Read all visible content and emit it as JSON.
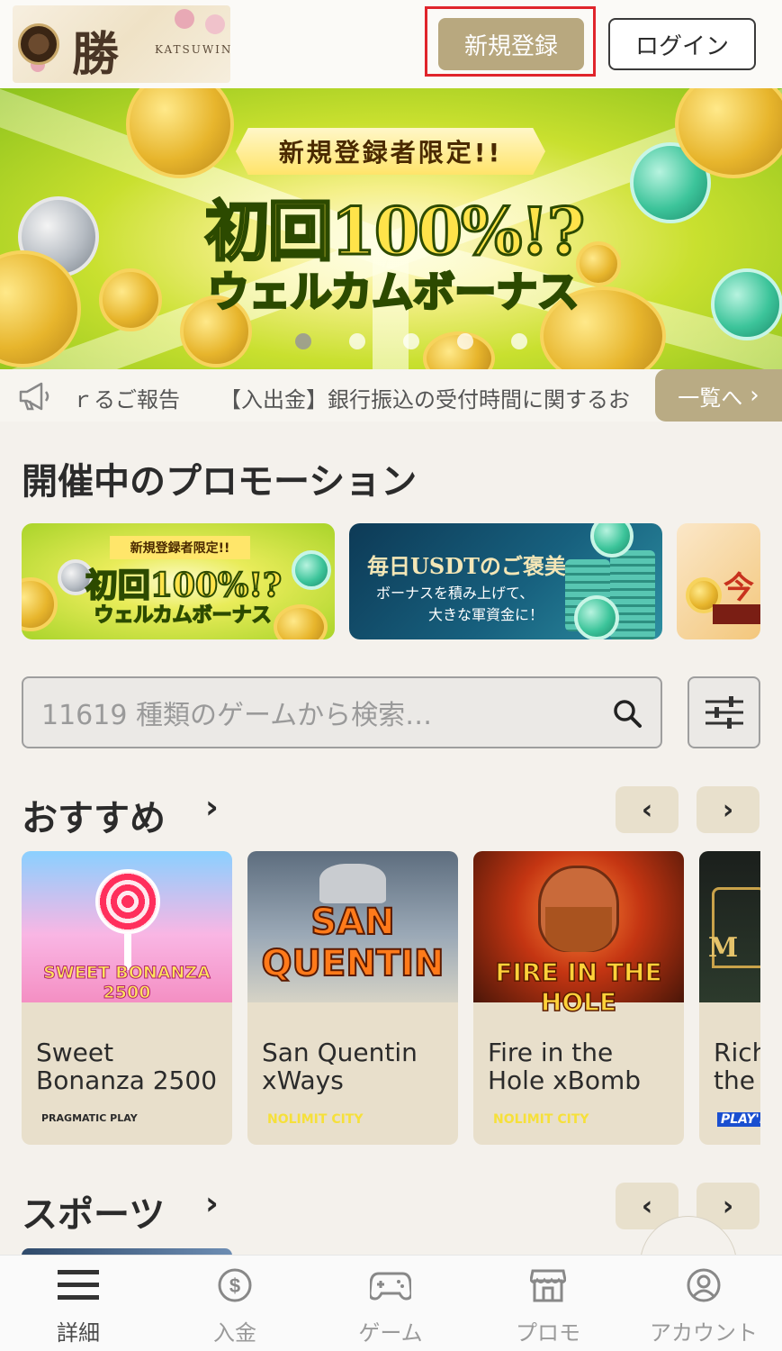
{
  "header": {
    "logo_kanji": "勝",
    "logo_brand": "KATSUWIN",
    "register_label": "新規登録",
    "login_label": "ログイン"
  },
  "banner": {
    "tag": "新規登録者限定!!",
    "main": "初回100%!?",
    "sub": "ウェルカムボーナス",
    "slide_count": 5,
    "active_slide": 1
  },
  "ticker": {
    "text1": "ｒるご報告",
    "text2": "【入出金】銀行振込の受付時間に関するお",
    "list_button": "一覧へ"
  },
  "promotions": {
    "title": "開催中のプロモーション",
    "card1": {
      "tag": "新規登録者限定!!",
      "main": "初回100%!?",
      "sub": "ウェルカムボーナス"
    },
    "card2": {
      "title": "毎日USDTのご褒美",
      "line1": "ボーナスを積み上げて、",
      "line2": "大きな軍資金に！"
    },
    "card3_text": "今"
  },
  "search": {
    "placeholder": "11619 種類のゲームから検索…"
  },
  "recommended": {
    "title": "おすすめ",
    "games": [
      {
        "name": "Sweet\nBonanza 2500",
        "art_title": "SWEET BONANZA 2500",
        "provider": "PRAGMATIC PLAY"
      },
      {
        "name": "San Quentin\nxWays",
        "art_title": "SAN QUENTIN",
        "provider": "NOLIMIT CITY"
      },
      {
        "name": "Fire in the\nHole xBomb",
        "art_title": "FIRE IN THE HOLE",
        "provider": "NOLIMIT CITY"
      },
      {
        "name": "Rich\nthe",
        "art_title": "M",
        "provider": "PLAY'n"
      }
    ]
  },
  "sports": {
    "title": "スポーツ"
  },
  "bottom_nav": [
    {
      "label": "詳細",
      "icon": "menu-icon"
    },
    {
      "label": "入金",
      "icon": "dollar-icon"
    },
    {
      "label": "ゲーム",
      "icon": "gamepad-icon"
    },
    {
      "label": "プロモ",
      "icon": "store-icon"
    },
    {
      "label": "アカウント",
      "icon": "user-icon"
    }
  ],
  "colors": {
    "accent": "#b8a87f",
    "highlight": "#e0242b",
    "background": "#f4f1ec"
  }
}
